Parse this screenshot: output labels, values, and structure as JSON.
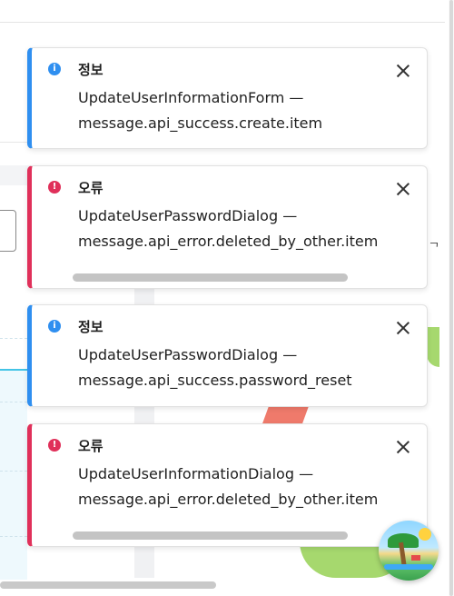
{
  "toasts": [
    {
      "kind": "info",
      "title": "정보",
      "line1": "UpdateUserInformationForm —",
      "line2": "message.api_success.create.item",
      "icon": "info-icon",
      "accent": "#2f8ff0",
      "close_icon": "close-icon"
    },
    {
      "kind": "error",
      "title": "오류",
      "line1": "UpdateUserPasswordDialog —",
      "line2": "message.api_error.deleted_by_other.item",
      "icon": "error-icon",
      "accent": "#e0305a",
      "close_icon": "close-icon"
    },
    {
      "kind": "info",
      "title": "정보",
      "line1": "UpdateUserPasswordDialog —",
      "line2": "message.api_success.password_reset",
      "icon": "info-icon",
      "accent": "#2f8ff0",
      "close_icon": "close-icon"
    },
    {
      "kind": "error",
      "title": "오류",
      "line1": "UpdateUserInformationDialog —",
      "line2": "message.api_error.deleted_by_other.item",
      "icon": "error-icon",
      "accent": "#e0305a",
      "close_icon": "close-icon"
    }
  ],
  "background": {
    "partial_char": "ᄀ"
  },
  "mascot": {
    "icon": "beach-island-icon"
  }
}
